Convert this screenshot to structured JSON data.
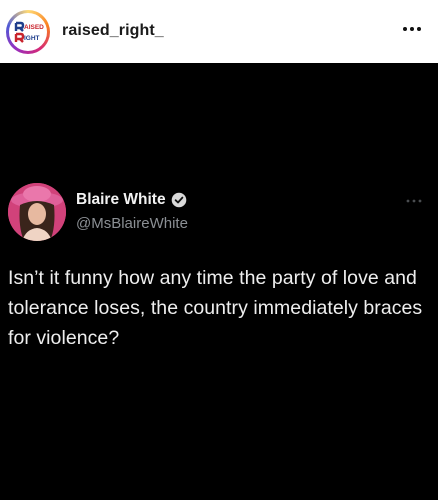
{
  "instagram": {
    "username": "raised_right_",
    "avatar_logo_text_line1": "AISED",
    "avatar_logo_text_line2": "IGHT",
    "more_icon": "more-horizontal-icon"
  },
  "tweet": {
    "display_name": "Blaire White",
    "handle": "@MsBlaireWhite",
    "verified": true,
    "text": "Isn’t it funny how any time the party of love and tolerance loses, the country immediately braces for violence?",
    "more_icon": "more-horizontal-icon"
  },
  "colors": {
    "background": "#000000",
    "header_background": "#ffffff",
    "handle_gray": "#8b8f94",
    "verified_badge": "#d9d9d9"
  }
}
